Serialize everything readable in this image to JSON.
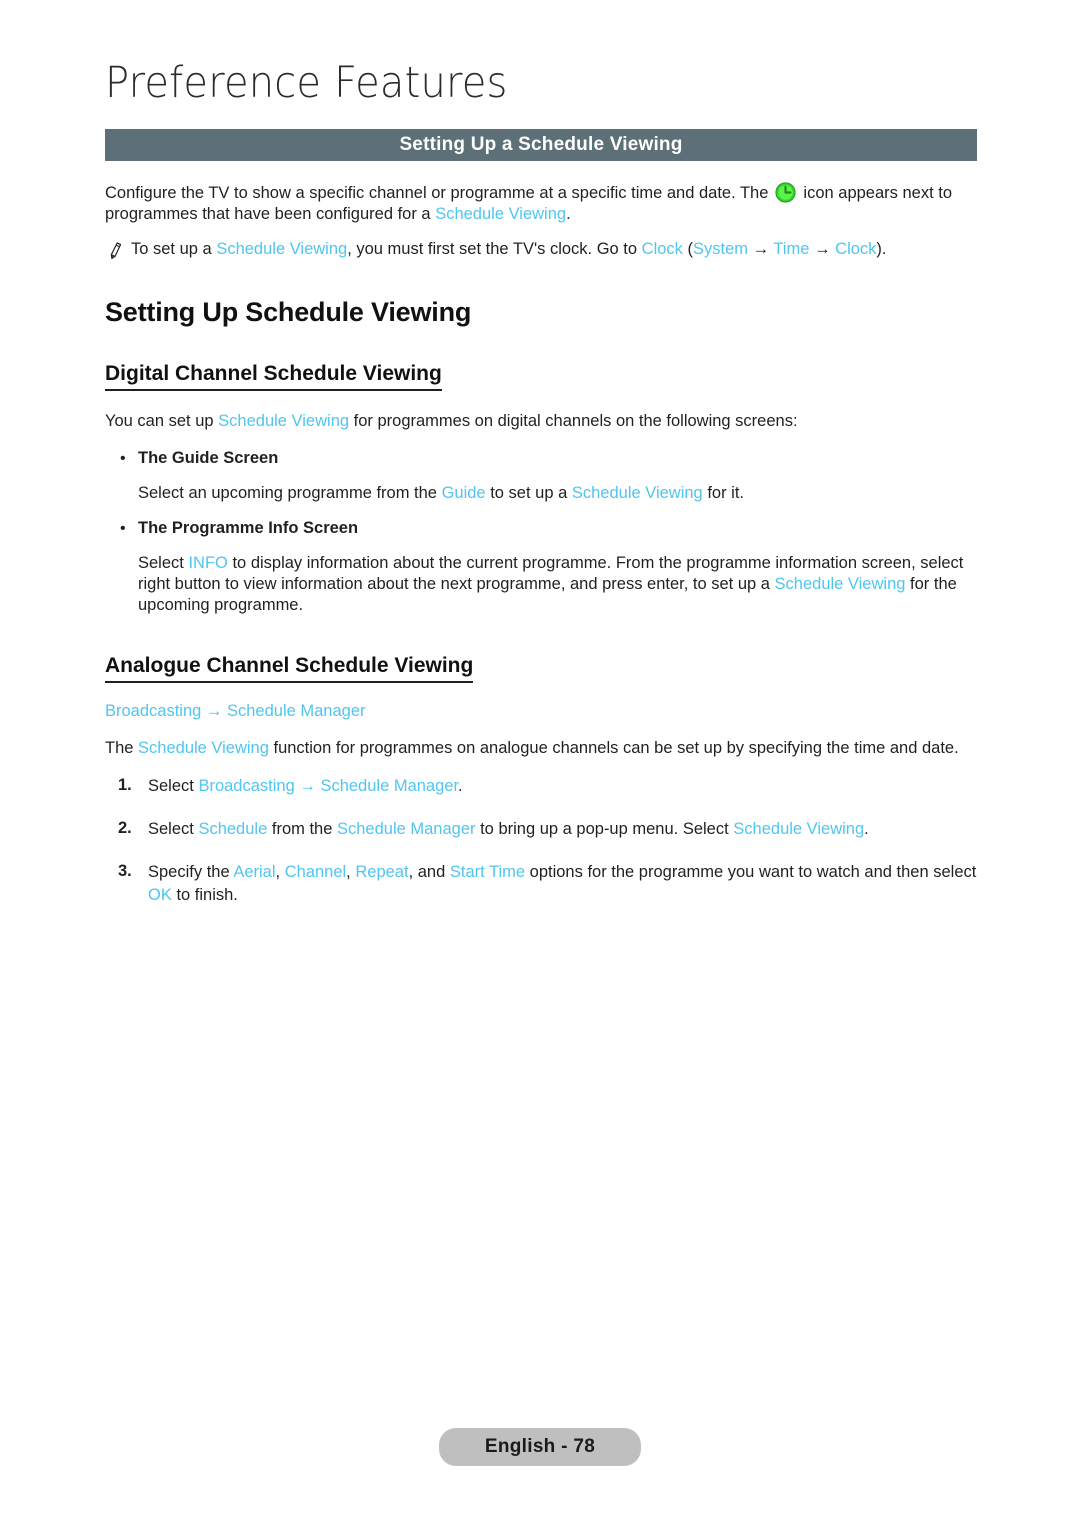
{
  "page": {
    "chapter_title": "Preference Features",
    "section_bar_title": "Setting Up a Schedule Viewing",
    "footer_label": "English - 78",
    "accent_link_color": "#4ec6f0",
    "section_bar_color": "#5d7077",
    "footer_pill_color": "#bfbfbf",
    "clock_icon_color": "#2fd425"
  },
  "intro": {
    "part1": "Configure the TV to show a specific channel or programme at a specific time and date. The",
    "icon_name": "green-clock-icon",
    "part2": "icon appears next to programmes that have been configured for a",
    "link": "Schedule Viewing",
    "part3": "."
  },
  "note": {
    "icon_name": "pencil-note-icon",
    "t1": "To set up a",
    "l1": "Schedule Viewing",
    "t2": ", you must first set the TV's clock. Go to",
    "l2": "Clock",
    "t3": "(",
    "l3": "System",
    "t4": " → ",
    "l4": "Time",
    "t5": " → ",
    "l5": "Clock",
    "t6": ")."
  },
  "major_heading": "Setting Up Schedule Viewing",
  "digital": {
    "heading": "Digital Channel Schedule Viewing",
    "intro_t1": "You can set up",
    "intro_l1": "Schedule Viewing",
    "intro_t2": "for programmes on digital channels on the following screens:",
    "bullets": [
      {
        "label": "The Guide Screen",
        "body_t1": "Select an upcoming programme from the",
        "body_l1": "Guide",
        "body_t2": "to set up a",
        "body_l2": "Schedule Viewing",
        "body_t3": "for it."
      },
      {
        "label": "The Programme Info Screen",
        "body_t1": "Select",
        "body_l1": "INFO",
        "body_t2": "to display information about the current programme. From the programme information screen, select right button to view information about the next programme, and press enter, to set up a",
        "body_l2": "Schedule Viewing",
        "body_t3": "for the upcoming programme."
      }
    ]
  },
  "analogue": {
    "heading": "Analogue Channel Schedule Viewing",
    "path_first": "Broadcasting",
    "path_arrow": "→",
    "path_second": "Schedule Manager",
    "desc_t1": "The",
    "desc_l1": "Schedule Viewing",
    "desc_t2": "function for programmes on analogue channels can be set up by specifying the time and date.",
    "steps": [
      {
        "num": "1.",
        "t1": "Select",
        "l1": "Broadcasting",
        "t2": " → ",
        "l2": "Schedule Manager",
        "t3": ".",
        "l3": "",
        "t4": "",
        "l4": "",
        "t5": ""
      },
      {
        "num": "2.",
        "t1": "Select",
        "l1": "Schedule",
        "t2": "from the",
        "l2": "Schedule Manager",
        "t3": "to bring up a pop-up menu. Select",
        "l3": "Schedule Viewing",
        "t4": ".",
        "l4": "",
        "t5": ""
      },
      {
        "num": "3.",
        "t1": "Specify the",
        "l1": "Aerial",
        "t2": ",",
        "l2": "Channel",
        "t3": ",",
        "l3": "Repeat",
        "t4": ", and",
        "l4": "Start Time",
        "t5": "options for the programme you want to watch and then select",
        "l5": "OK",
        "t6": "to finish."
      }
    ]
  }
}
